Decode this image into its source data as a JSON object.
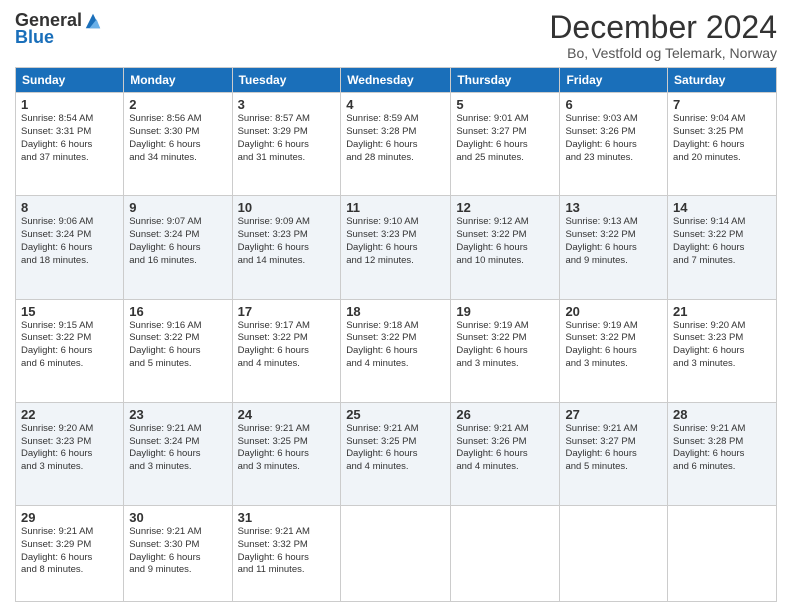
{
  "logo": {
    "general": "General",
    "blue": "Blue"
  },
  "title": "December 2024",
  "subtitle": "Bo, Vestfold og Telemark, Norway",
  "header_days": [
    "Sunday",
    "Monday",
    "Tuesday",
    "Wednesday",
    "Thursday",
    "Friday",
    "Saturday"
  ],
  "weeks": [
    [
      {
        "day": "1",
        "info": "Sunrise: 8:54 AM\nSunset: 3:31 PM\nDaylight: 6 hours\nand 37 minutes."
      },
      {
        "day": "2",
        "info": "Sunrise: 8:56 AM\nSunset: 3:30 PM\nDaylight: 6 hours\nand 34 minutes."
      },
      {
        "day": "3",
        "info": "Sunrise: 8:57 AM\nSunset: 3:29 PM\nDaylight: 6 hours\nand 31 minutes."
      },
      {
        "day": "4",
        "info": "Sunrise: 8:59 AM\nSunset: 3:28 PM\nDaylight: 6 hours\nand 28 minutes."
      },
      {
        "day": "5",
        "info": "Sunrise: 9:01 AM\nSunset: 3:27 PM\nDaylight: 6 hours\nand 25 minutes."
      },
      {
        "day": "6",
        "info": "Sunrise: 9:03 AM\nSunset: 3:26 PM\nDaylight: 6 hours\nand 23 minutes."
      },
      {
        "day": "7",
        "info": "Sunrise: 9:04 AM\nSunset: 3:25 PM\nDaylight: 6 hours\nand 20 minutes."
      }
    ],
    [
      {
        "day": "8",
        "info": "Sunrise: 9:06 AM\nSunset: 3:24 PM\nDaylight: 6 hours\nand 18 minutes."
      },
      {
        "day": "9",
        "info": "Sunrise: 9:07 AM\nSunset: 3:24 PM\nDaylight: 6 hours\nand 16 minutes."
      },
      {
        "day": "10",
        "info": "Sunrise: 9:09 AM\nSunset: 3:23 PM\nDaylight: 6 hours\nand 14 minutes."
      },
      {
        "day": "11",
        "info": "Sunrise: 9:10 AM\nSunset: 3:23 PM\nDaylight: 6 hours\nand 12 minutes."
      },
      {
        "day": "12",
        "info": "Sunrise: 9:12 AM\nSunset: 3:22 PM\nDaylight: 6 hours\nand 10 minutes."
      },
      {
        "day": "13",
        "info": "Sunrise: 9:13 AM\nSunset: 3:22 PM\nDaylight: 6 hours\nand 9 minutes."
      },
      {
        "day": "14",
        "info": "Sunrise: 9:14 AM\nSunset: 3:22 PM\nDaylight: 6 hours\nand 7 minutes."
      }
    ],
    [
      {
        "day": "15",
        "info": "Sunrise: 9:15 AM\nSunset: 3:22 PM\nDaylight: 6 hours\nand 6 minutes."
      },
      {
        "day": "16",
        "info": "Sunrise: 9:16 AM\nSunset: 3:22 PM\nDaylight: 6 hours\nand 5 minutes."
      },
      {
        "day": "17",
        "info": "Sunrise: 9:17 AM\nSunset: 3:22 PM\nDaylight: 6 hours\nand 4 minutes."
      },
      {
        "day": "18",
        "info": "Sunrise: 9:18 AM\nSunset: 3:22 PM\nDaylight: 6 hours\nand 4 minutes."
      },
      {
        "day": "19",
        "info": "Sunrise: 9:19 AM\nSunset: 3:22 PM\nDaylight: 6 hours\nand 3 minutes."
      },
      {
        "day": "20",
        "info": "Sunrise: 9:19 AM\nSunset: 3:22 PM\nDaylight: 6 hours\nand 3 minutes."
      },
      {
        "day": "21",
        "info": "Sunrise: 9:20 AM\nSunset: 3:23 PM\nDaylight: 6 hours\nand 3 minutes."
      }
    ],
    [
      {
        "day": "22",
        "info": "Sunrise: 9:20 AM\nSunset: 3:23 PM\nDaylight: 6 hours\nand 3 minutes."
      },
      {
        "day": "23",
        "info": "Sunrise: 9:21 AM\nSunset: 3:24 PM\nDaylight: 6 hours\nand 3 minutes."
      },
      {
        "day": "24",
        "info": "Sunrise: 9:21 AM\nSunset: 3:25 PM\nDaylight: 6 hours\nand 3 minutes."
      },
      {
        "day": "25",
        "info": "Sunrise: 9:21 AM\nSunset: 3:25 PM\nDaylight: 6 hours\nand 4 minutes."
      },
      {
        "day": "26",
        "info": "Sunrise: 9:21 AM\nSunset: 3:26 PM\nDaylight: 6 hours\nand 4 minutes."
      },
      {
        "day": "27",
        "info": "Sunrise: 9:21 AM\nSunset: 3:27 PM\nDaylight: 6 hours\nand 5 minutes."
      },
      {
        "day": "28",
        "info": "Sunrise: 9:21 AM\nSunset: 3:28 PM\nDaylight: 6 hours\nand 6 minutes."
      }
    ],
    [
      {
        "day": "29",
        "info": "Sunrise: 9:21 AM\nSunset: 3:29 PM\nDaylight: 6 hours\nand 8 minutes."
      },
      {
        "day": "30",
        "info": "Sunrise: 9:21 AM\nSunset: 3:30 PM\nDaylight: 6 hours\nand 9 minutes."
      },
      {
        "day": "31",
        "info": "Sunrise: 9:21 AM\nSunset: 3:32 PM\nDaylight: 6 hours\nand 11 minutes."
      },
      null,
      null,
      null,
      null
    ]
  ]
}
